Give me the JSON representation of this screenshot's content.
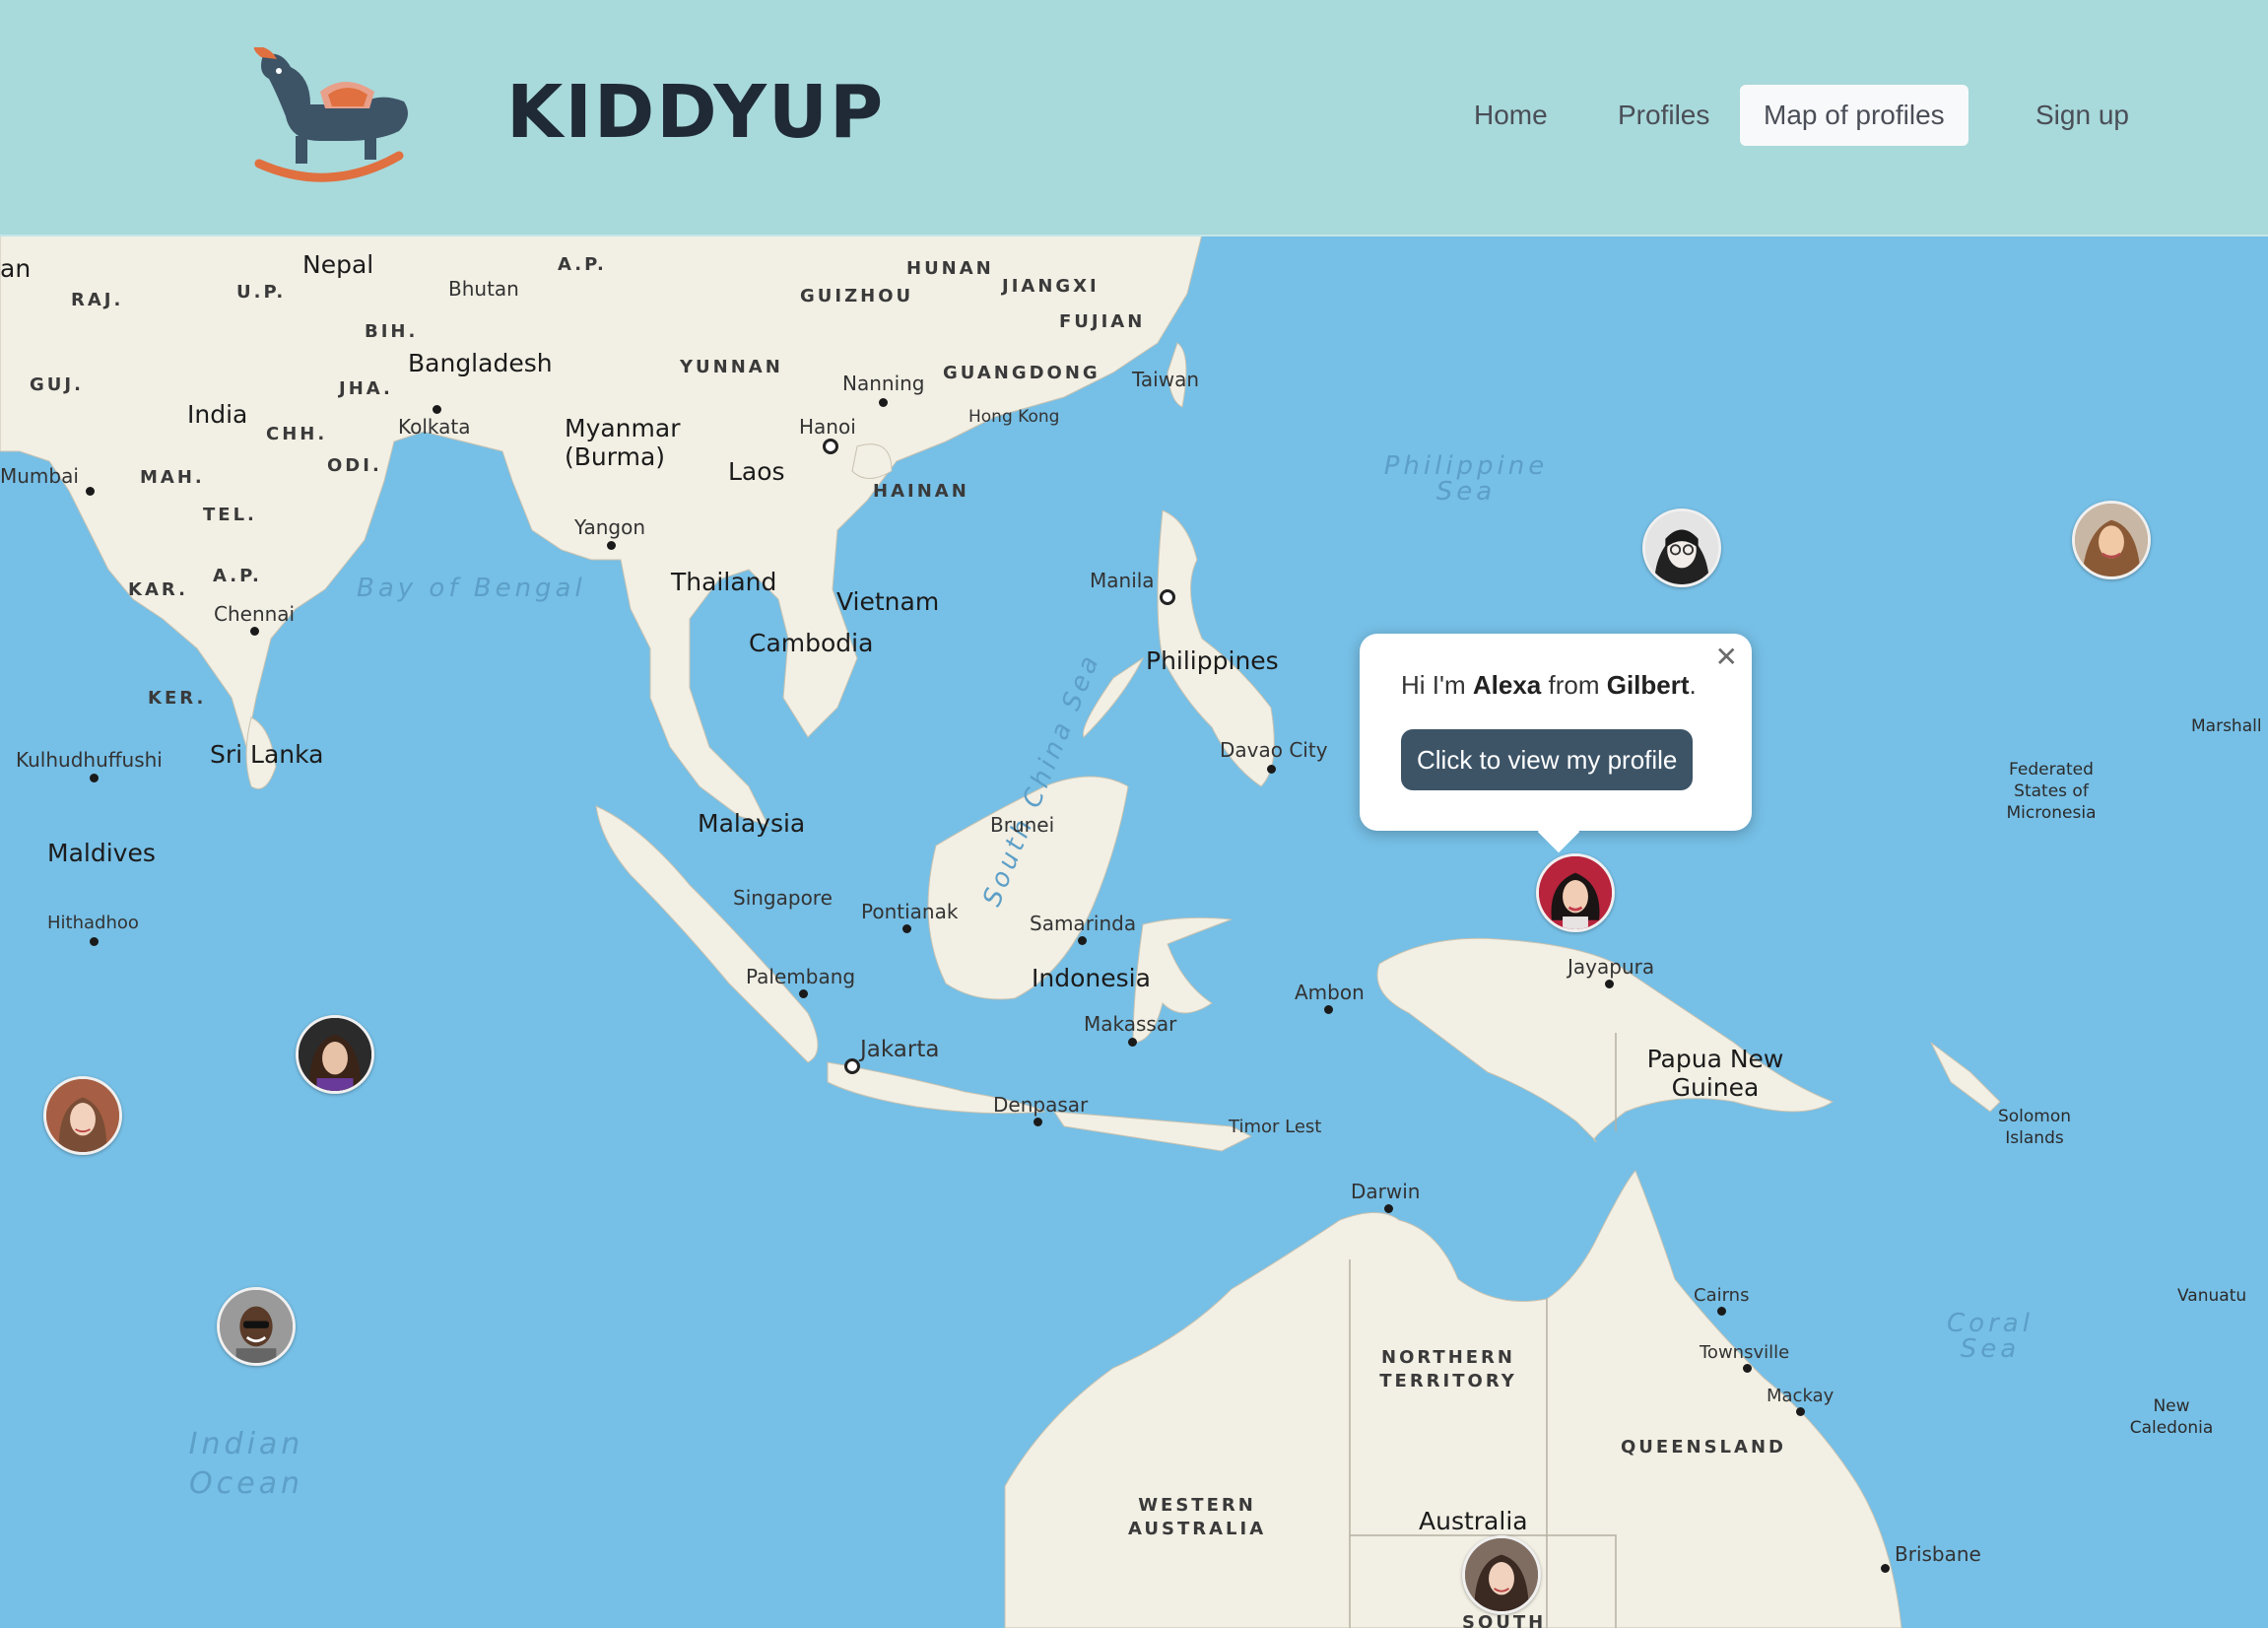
{
  "brand": {
    "name": "KIDDYUP",
    "logo_icon": "rocking-horse-icon"
  },
  "nav": {
    "items": [
      {
        "label": "Home"
      },
      {
        "label": "Profiles"
      },
      {
        "label": "Map of profiles",
        "active": true
      },
      {
        "label": "Sign up"
      }
    ]
  },
  "colors": {
    "header_bg": "#a8d9db",
    "ocean": "#76bfe6",
    "land": "#f2efe4",
    "button": "#3d5467"
  },
  "popup": {
    "greeting_prefix": "Hi I'm",
    "name": "Alexa",
    "from": "from",
    "place": "Gilbert",
    "period": ".",
    "button_label": "Click to view my profile",
    "close_icon": "close-icon"
  },
  "map_labels": {
    "countries": [
      "Nepal",
      "Bhutan",
      "Bangladesh",
      "India",
      "Myanmar (Burma)",
      "Laos",
      "Thailand",
      "Vietnam",
      "Cambodia",
      "Sri Lanka",
      "Maldives",
      "Malaysia",
      "Brunei",
      "Singapore",
      "Indonesia",
      "Philippines",
      "Taiwan",
      "Papua New Guinea",
      "Timor Lest",
      "Australia"
    ],
    "states": [
      "RAJ.",
      "U.P.",
      "A.P.",
      "BIH.",
      "GUJ.",
      "JHA.",
      "CHH.",
      "MAH.",
      "ODI.",
      "TEL.",
      "KAR.",
      "A.P.",
      "KER.",
      "HUNAN",
      "JIANGXI",
      "GUIZHOU",
      "FUJIAN",
      "YUNNAN",
      "GUANGDONG",
      "HAINAN",
      "NORTHERN TERRITORY",
      "WESTERN AUSTRALIA",
      "QUEENSLAND",
      "SOUTH"
    ],
    "cities": [
      "Kolkata",
      "Mumbai",
      "Chennai",
      "Yangon",
      "Nanning",
      "Hanoi",
      "Hong Kong",
      "Manila",
      "Davao City",
      "Kulhudhuffushi",
      "Hithadhoo",
      "Pontianak",
      "Samarinda",
      "Palembang",
      "Jakarta",
      "Makassar",
      "Denpasar",
      "Ambon",
      "Jayapura",
      "Darwin",
      "Cairns",
      "Townsville",
      "Mackay",
      "Brisbane"
    ],
    "seas": [
      "Bay of Bengal",
      "South China Sea",
      "Philippine Sea",
      "Indian Ocean",
      "Coral Sea"
    ],
    "islands": [
      "Marshall Islands",
      "Federated States of Micronesia",
      "Solomon Islands",
      "Vanuatu",
      "New Caledonia"
    ],
    "edge": [
      "an"
    ]
  },
  "avatars": [
    {
      "name": "profile-avatar-philippine-sea"
    },
    {
      "name": "profile-avatar-pacific"
    },
    {
      "name": "profile-avatar-alexa"
    },
    {
      "name": "profile-avatar-indian-ocean-1"
    },
    {
      "name": "profile-avatar-indian-ocean-2"
    },
    {
      "name": "profile-avatar-indian-ocean-3"
    },
    {
      "name": "profile-avatar-australia"
    }
  ]
}
